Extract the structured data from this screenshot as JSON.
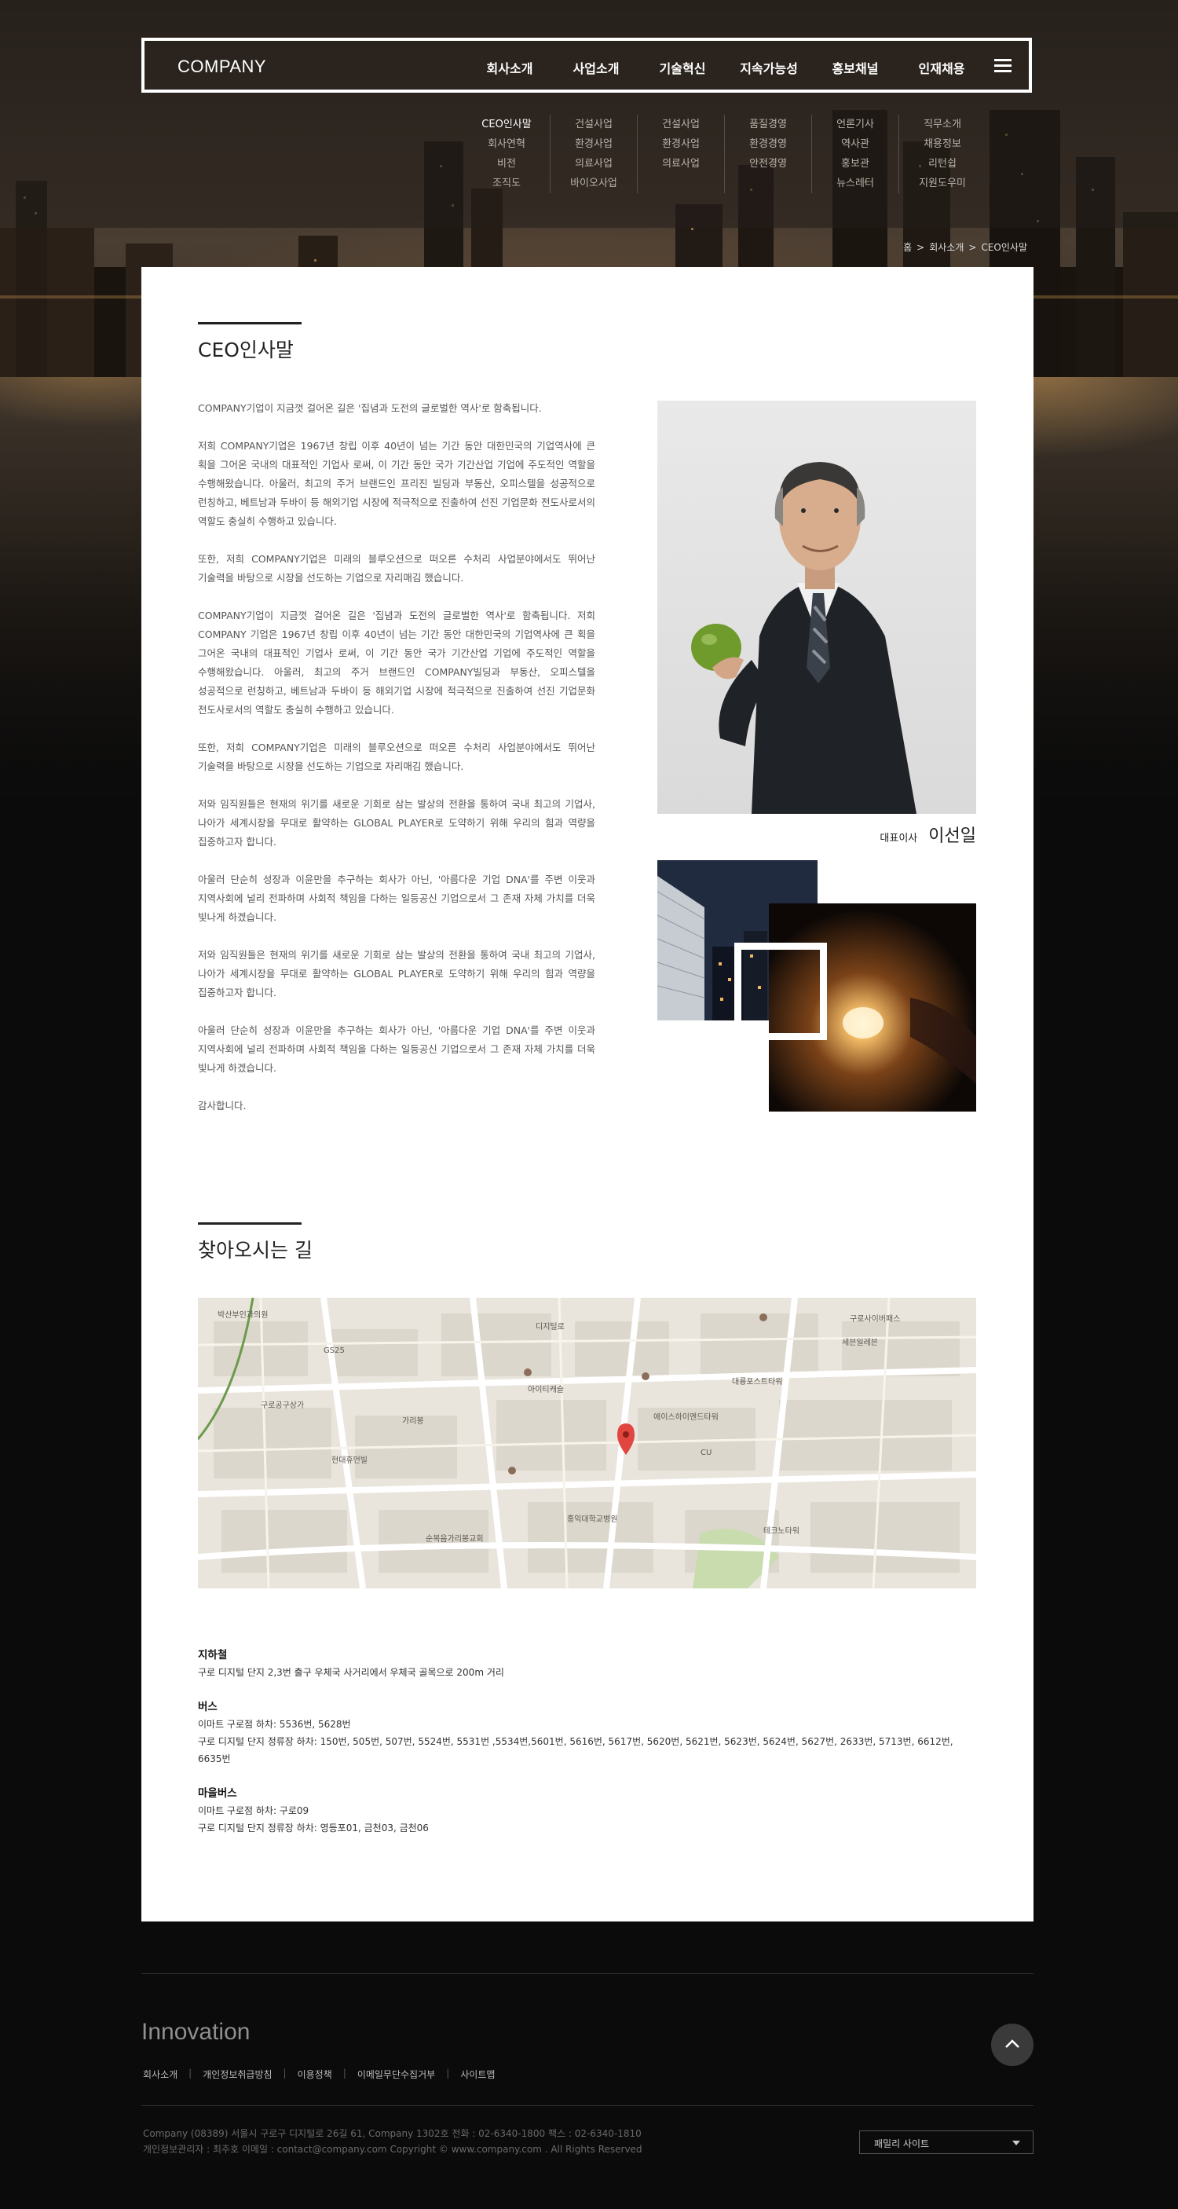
{
  "header": {
    "logo": "COMPANY",
    "nav": [
      "회사소개",
      "사업소개",
      "기술혁신",
      "지속가능성",
      "홍보채널",
      "인재채용"
    ],
    "submenu": [
      [
        "CEO인사말",
        "회사연혁",
        "비전",
        "조직도"
      ],
      [
        "건설사업",
        "환경사업",
        "의료사업",
        "바이오사업"
      ],
      [
        "건설사업",
        "환경사업",
        "의료사업"
      ],
      [
        "품질경영",
        "환경경영",
        "안전경영"
      ],
      [
        "언론기사",
        "역사관",
        "홍보관",
        "뉴스레터"
      ],
      [
        "직무소개",
        "채용정보",
        "리턴쉽",
        "지원도우미"
      ]
    ]
  },
  "breadcrumb": [
    "홈",
    "회사소개",
    "CEO인사말"
  ],
  "greeting": {
    "title": "CEO인사말",
    "paragraphs": [
      "COMPANY기업이 지금껏 걸어온 길은 '집념과 도전의 글로벌한 역사'로 함축됩니다.",
      "저희 COMPANY기업은 1967년 창립 이후 40년이 넘는 기간 동안 대한민국의 기업역사에 큰 획을 그어온 국내의 대표적인 기업사 로써, 이 기간 동안 국가 기간산업 기업에 주도적인 역할을 수행해왔습니다. 아울러, 최고의 주거 브랜드인 프리진 빌딩과 부동산, 오피스텔을 성공적으로 런칭하고, 베트남과 두바이 등 해외기업 시장에 적극적으로 진출하여 선진 기업문화 전도사로서의 역할도 충실히 수행하고 있습니다.",
      "또한, 저희 COMPANY기업은 미래의 블루오션으로 떠오른 수처리 사업분야에서도 뛰어난 기술력을 바탕으로 시장을 선도하는 기업으로 자리매김 했습니다.",
      "COMPANY기업이 지금껏 걸어온 길은 '집념과 도전의 글로벌한 역사'로 함축됩니다. 저희 COMPANY 기업은 1967년 창립 이후 40년이 넘는 기간 동안 대한민국의 기업역사에 큰 획을 그어온 국내의 대표적인 기업사 로써, 이 기간 동안 국가 기간산업 기업에 주도적인 역할을 수행해왔습니다. 아울러, 최고의 주거 브랜드인 COMPANY빌딩과 부동산, 오피스텔을 성공적으로 런칭하고, 베트남과 두바이 등 해외기업 시장에 적극적으로 진출하여 선진 기업문화 전도사로서의 역할도 충실히 수행하고 있습니다.",
      "또한, 저희 COMPANY기업은 미래의 블루오션으로 떠오른 수처리 사업분야에서도 뛰어난 기술력을 바탕으로 시장을 선도하는 기업으로 자리매김 했습니다.",
      "저와 임직원들은 현재의 위기를 새로운 기회로 삼는 발상의 전환을 통하여 국내 최고의 기업사, 나아가 세계시장을 무대로 활약하는 GLOBAL PLAYER로 도약하기 위해 우리의 힘과 역량을 집중하고자 합니다.",
      "아울러 단순히 성장과 이윤만을 추구하는 회사가 아닌, '아름다운 기업 DNA'를 주변 이웃과 지역사회에 널리 전파하며 사회적 책임을 다하는 일등공신 기업으로서 그 존재 자체 가치를 더욱 빛나게 하겠습니다.",
      "저와 임직원들은 현재의 위기를 새로운 기회로 삼는 발상의 전환을 통하여 국내 최고의 기업사, 나아가 세계시장을 무대로 활약하는 GLOBAL PLAYER로 도약하기 위해 우리의 힘과 역량을 집중하고자 합니다.",
      "아울러 단순히 성장과 이윤만을 추구하는 회사가 아닌, '아름다운 기업 DNA'를 주변 이웃과 지역사회에 널리 전파하며 사회적 책임을 다하는 일등공신 기업으로서 그 존재 자체 가치를 더욱 빛나게 하겠습니다.",
      "감사합니다."
    ],
    "ceo_role": "대표이사",
    "ceo_name": "이선일"
  },
  "location": {
    "title": "찾아오시는 길",
    "map_labels": [
      "박산부인과의원",
      "구로사이버패스",
      "에이스하이엔드타워",
      "아이티캐슬",
      "대륭포스트타워",
      "디지털로",
      "현대휴먼빌",
      "가리봉",
      "순복음가리봉교회",
      "홍익대학교병원",
      "세븐일레븐",
      "구로공구상가",
      "테크노타워",
      "GS25",
      "CU"
    ],
    "subway_title": "지하철",
    "subway_text": "구로 디지털 단지 2,3번 출구 우체국 사거리에서 우체국 골목으로 200m 거리",
    "bus_title": "버스",
    "bus_line1": "이마트 구로점 하차: 5536번, 5628번",
    "bus_line2": "구로 디지털 단지 정류장 하차: 150번, 505번, 507번, 5524번, 5531번 ,5534번,5601번, 5616번, 5617번, 5620번, 5621번, 5623번, 5624번, 5627번, 2633번, 5713번, 6612번, 6635번",
    "village_title": "마을버스",
    "village_line1": "이마트 구로점 하차: 구로09",
    "village_line2": "구로 디지털 단지 정류장 하차: 영등포01, 금천03, 금천06"
  },
  "footer": {
    "logo": "Innovation",
    "links": [
      "회사소개",
      "개인정보취급방침",
      "이용정책",
      "이메일무단수집거부",
      "사이트맵"
    ],
    "info_line1": "Company  (08389) 서울시 구로구 디지털로 26길 61, Company  1302호 전화 : 02-6340-1800 팩스 : 02-6340-1810",
    "info_line2": "개인정보관리자 : 최주호    이메일 : contact@company.com    Copyright © www.company.com  .  All Rights Reserved",
    "family_site": "패밀리 사이트"
  }
}
